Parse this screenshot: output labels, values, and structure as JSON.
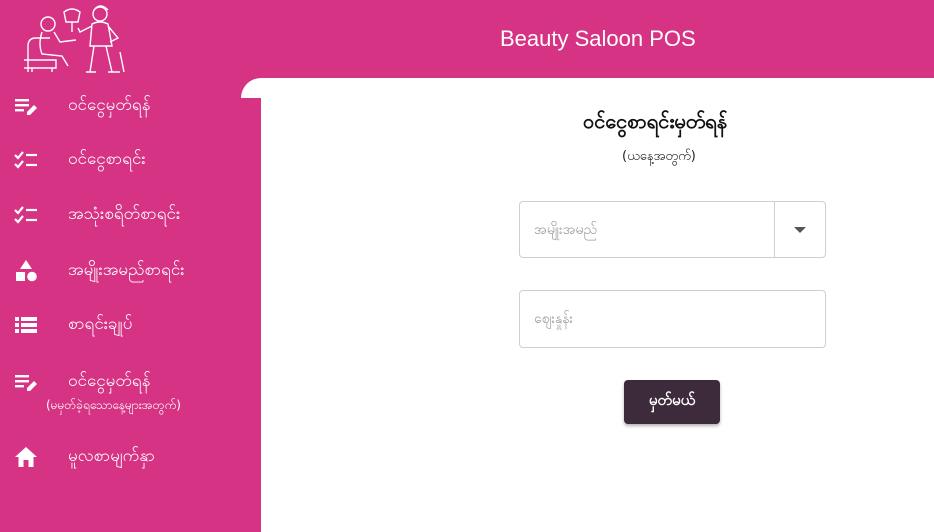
{
  "header": {
    "title": "Beauty Saloon POS",
    "logo_icon": "salon-stylist-illustration"
  },
  "sidebar": {
    "items": [
      {
        "label": "ဝင်ငွေမှတ်ရန်",
        "icon": "edit-note-icon"
      },
      {
        "label": "ဝင်ငွေစာရင်း",
        "icon": "checklist-icon"
      },
      {
        "label": "အသုံးစရိတ်စာရင်း",
        "icon": "checklist-icon"
      },
      {
        "label": "အမျိုးအမည်စာရင်း",
        "icon": "category-icon"
      },
      {
        "label": "စာရင်းချုပ်",
        "icon": "list-icon"
      },
      {
        "label": "ဝင်ငွေမှတ်ရန်",
        "sublabel": "(မမှတ်ခဲ့ရသောနေ့များအတွက်)",
        "icon": "edit-note-icon"
      },
      {
        "label": "မူလစာမျက်နှာ",
        "icon": "home-icon"
      }
    ]
  },
  "form": {
    "title": "ဝင်ငွေစာရင်းမှတ်ရန်",
    "subtitle": "(ယနေ့အတွက်)",
    "category_placeholder": "အမျိုးအမည်",
    "price_placeholder": "ဈေးနှုန်း",
    "submit_label": "မှတ်မယ်"
  },
  "colors": {
    "primary": "#d63384",
    "button": "#3d2a3a"
  }
}
